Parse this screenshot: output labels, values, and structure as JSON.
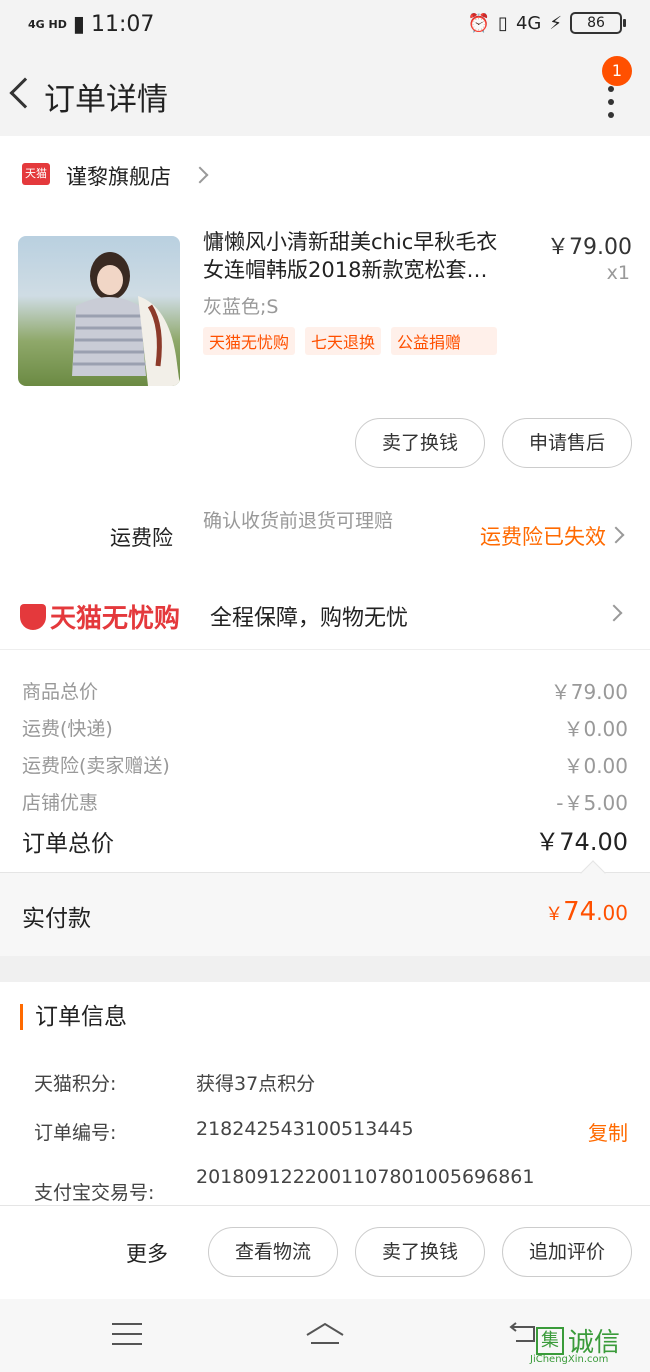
{
  "status_bar": {
    "network": "4G HD",
    "time": "11:07",
    "network_right": "4G",
    "battery": "86"
  },
  "header": {
    "title": "订单详情",
    "badge_count": "1"
  },
  "store": {
    "logo_text": "天猫",
    "name": "谨黎旗舰店"
  },
  "product": {
    "title_line1": "慵懒风小清新甜美chic早秋毛衣",
    "title_line2": "女连帽韩版2018新款宽松套…",
    "price": "￥79.00",
    "quantity": "x1",
    "sku": "灰蓝色;S",
    "tags": [
      "天猫无忧购",
      "七天退换",
      "公益捐赠"
    ],
    "actions": [
      "卖了换钱",
      "申请售后"
    ]
  },
  "shipping_insurance": {
    "label": "运费险",
    "description": "确认收货前退货可理赔",
    "status": "运费险已失效"
  },
  "worry_free": {
    "brand": "天猫无忧购",
    "text": "全程保障，购物无忧"
  },
  "price_summary": {
    "rows": [
      {
        "label": "商品总价",
        "value": "￥79.00"
      },
      {
        "label": "运费(快递)",
        "value": "￥0.00"
      },
      {
        "label": "运费险(卖家赠送)",
        "value": "￥0.00"
      },
      {
        "label": "店铺优惠",
        "value": "-￥5.00"
      }
    ],
    "total_label": "订单总价",
    "total_value": "￥74.00",
    "paid_label": "实付款",
    "paid_currency": "￥",
    "paid_integer": "74",
    "paid_decimal": ".00"
  },
  "order_info": {
    "heading": "订单信息",
    "points_label": "天猫积分:",
    "points_value": "获得37点积分",
    "order_no_label": "订单编号:",
    "order_no_value": "218242543100513445",
    "copy_label": "复制",
    "alipay_label": "支付宝交易号:",
    "alipay_value": "2018091222001107801005696861"
  },
  "bottom_bar": {
    "more_label": "更多",
    "buttons": [
      "查看物流",
      "卖了换钱",
      "追加评价"
    ]
  },
  "watermark": {
    "char": "集",
    "text": "诚信",
    "url": "JiChengXin.com"
  },
  "colors": {
    "accent": "#ff5000",
    "tmall_red": "#e4393c",
    "muted": "#999999"
  }
}
